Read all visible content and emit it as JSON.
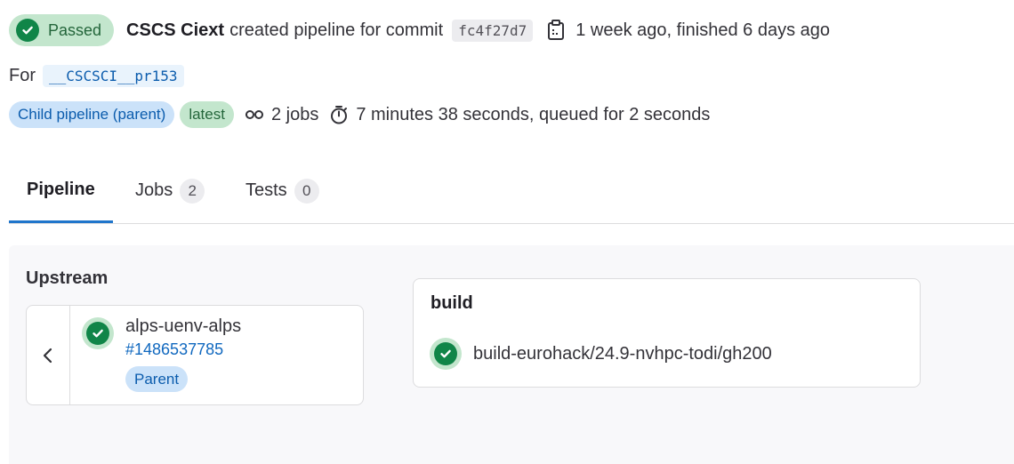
{
  "header": {
    "status_label": "Passed",
    "author": "CSCS Ciext",
    "action_text": "created pipeline for commit",
    "commit_sha": "fc4f27d7",
    "time_text": "1 week ago, finished 6 days ago",
    "for_label": "For",
    "ref": "__CSCSCI__pr153",
    "badge_child": "Child pipeline (parent)",
    "badge_latest": "latest",
    "jobs_text": "2 jobs",
    "duration_text": "7 minutes 38 seconds, queued for 2 seconds"
  },
  "tabs": [
    {
      "label": "Pipeline",
      "count": null
    },
    {
      "label": "Jobs",
      "count": "2"
    },
    {
      "label": "Tests",
      "count": "0"
    }
  ],
  "graph": {
    "upstream_title": "Upstream",
    "upstream": {
      "project": "alps-uenv-alps",
      "pipeline_id": "#1486537785",
      "relation": "Parent"
    },
    "stage": {
      "name": "build",
      "jobs": [
        {
          "name": "build-eurohack/24.9-nvhpc-todi/gh200",
          "status": "passed"
        }
      ]
    }
  },
  "icons": {
    "status": "status-success-icon",
    "copy": "copy-to-clipboard-icon",
    "jobs": "pipeline-jobs-icon",
    "timer": "timer-icon",
    "collapse": "chevron-left-icon"
  },
  "colors": {
    "success": "#108548",
    "success_bg": "#c3e6cd",
    "link": "#1068bf",
    "tab_active": "#1f75cb"
  }
}
